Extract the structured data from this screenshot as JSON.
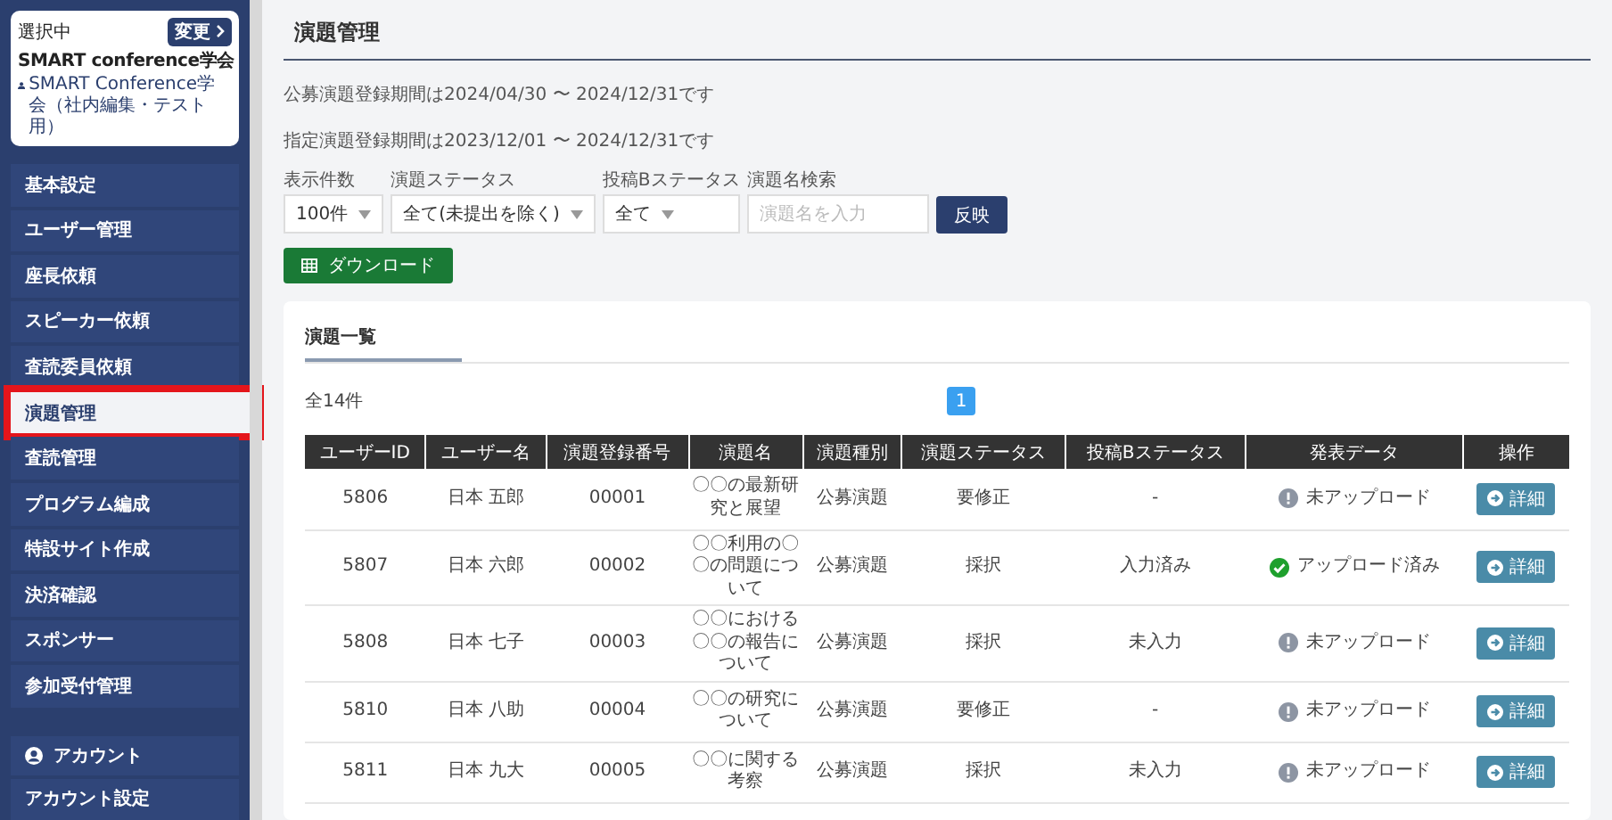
{
  "org_card": {
    "status": "選択中",
    "change_button": "変更",
    "name": "SMART conference学会",
    "sub": "SMART Conference学会（社内編集・テスト用）"
  },
  "sidebar": {
    "items": [
      {
        "label": "基本設定",
        "selected": false
      },
      {
        "label": "ユーザー管理",
        "selected": false
      },
      {
        "label": "座長依頼",
        "selected": false
      },
      {
        "label": "スピーカー依頼",
        "selected": false
      },
      {
        "label": "査読委員依頼",
        "selected": false
      },
      {
        "label": "演題管理",
        "selected": true
      },
      {
        "label": "査読管理",
        "selected": false
      },
      {
        "label": "プログラム編成",
        "selected": false
      },
      {
        "label": "特設サイト作成",
        "selected": false
      },
      {
        "label": "決済確認",
        "selected": false
      },
      {
        "label": "スポンサー",
        "selected": false
      },
      {
        "label": "参加受付管理",
        "selected": false
      }
    ],
    "account": {
      "heading": "アカウント",
      "items": [
        "アカウント設定"
      ]
    }
  },
  "page_title": "演題管理",
  "notices": [
    "公募演題登録期間は2024/04/30 〜 2024/12/31です",
    "指定演題登録期間は2023/12/01 〜 2024/12/31です"
  ],
  "filters": [
    {
      "label": "表示件数",
      "value": "100件",
      "kind": "select"
    },
    {
      "label": "演題ステータス",
      "value": "全て(未提出を除く)",
      "kind": "select"
    },
    {
      "label": "投稿Bステータス",
      "value": "全て",
      "kind": "select"
    },
    {
      "label": "演題名検索",
      "placeholder": "演題名を入力",
      "kind": "search"
    }
  ],
  "apply_button": "反映",
  "download_button": "ダウンロード",
  "list": {
    "tab": "演題一覧",
    "total": "全14件",
    "pages": [
      {
        "label": "1",
        "selected": true
      }
    ],
    "columns": [
      "ユーザーID",
      "ユーザー名",
      "演題登録番号",
      "演題名",
      "演題種別",
      "演題ステータス",
      "投稿Bステータス",
      "発表データ",
      "操作"
    ],
    "rows": [
      {
        "id": "5806",
        "user": "日本 五郎",
        "number": "00001",
        "title": "〇〇の最新研究と展望",
        "type": "公募演題",
        "status": "要修正",
        "b_status": "-",
        "uploaded": false,
        "data": "未アップロード",
        "action": "詳細"
      },
      {
        "id": "5807",
        "user": "日本 六郎",
        "number": "00002",
        "title": "〇〇利用の〇〇の問題について",
        "type": "公募演題",
        "status": "採択",
        "b_status": "入力済み",
        "uploaded": true,
        "data": "アップロード済み",
        "action": "詳細"
      },
      {
        "id": "5808",
        "user": "日本 七子",
        "number": "00003",
        "title": "〇〇における〇〇の報告について",
        "type": "公募演題",
        "status": "採択",
        "b_status": "未入力",
        "uploaded": false,
        "data": "未アップロード",
        "action": "詳細"
      },
      {
        "id": "5810",
        "user": "日本 八助",
        "number": "00004",
        "title": "〇〇の研究について",
        "type": "公募演題",
        "status": "要修正",
        "b_status": "-",
        "uploaded": false,
        "data": "未アップロード",
        "action": "詳細"
      },
      {
        "id": "5811",
        "user": "日本 九大",
        "number": "00005",
        "title": "〇〇に関する考察",
        "type": "公募演題",
        "status": "採択",
        "b_status": "未入力",
        "uploaded": false,
        "data": "未アップロード",
        "action": "詳細"
      }
    ]
  }
}
